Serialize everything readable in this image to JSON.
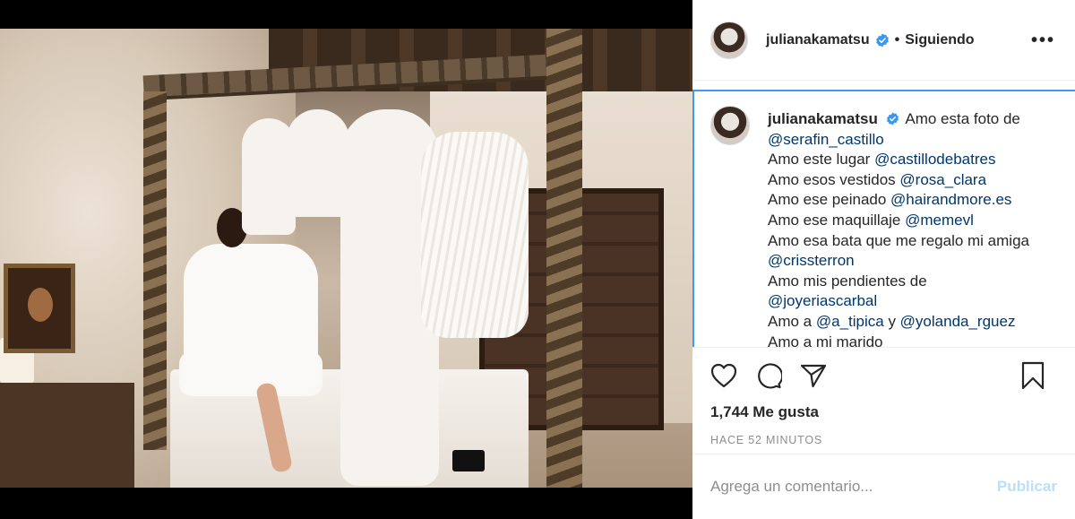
{
  "post": {
    "username": "julianakamatsu",
    "follow_separator": "•",
    "follow_status": "Siguiendo",
    "more_label": "•••"
  },
  "caption": {
    "username": "julianakamatsu",
    "lines": [
      {
        "text": "Amo esta foto de",
        "mention": ""
      },
      {
        "text": "",
        "mention": "@serafin_castillo"
      },
      {
        "text": "Amo este lugar ",
        "mention": "@castillodebatres"
      },
      {
        "text": "Amo esos vestidos ",
        "mention": "@rosa_clara"
      },
      {
        "text": "Amo ese peinado ",
        "mention": "@hairandmore.es"
      },
      {
        "text": "Amo ese maquillaje ",
        "mention": "@memevl"
      },
      {
        "text": "Amo esa bata que me regalo mi amiga",
        "mention": ""
      },
      {
        "text": "",
        "mention": "@crissterron"
      },
      {
        "text": "Amo mis pendientes de",
        "mention": ""
      },
      {
        "text": "",
        "mention": "@joyeriascarbal"
      },
      {
        "text": "Amo a ",
        "mention": "@a_tipica",
        "text2": " y ",
        "mention2": "@yolanda_rguez"
      },
      {
        "text": "Amo a mi marido",
        "mention": ""
      }
    ]
  },
  "actions": {
    "like_icon": "heart-icon",
    "comment_icon": "comment-icon",
    "share_icon": "paper-plane-icon",
    "save_icon": "bookmark-icon"
  },
  "likes": "1,744 Me gusta",
  "time_ago": "HACE 52 MINUTOS",
  "comment": {
    "placeholder": "Agrega un comentario...",
    "publish_label": "Publicar"
  },
  "colors": {
    "verified": "#3897f0",
    "mention": "#00376b",
    "publish_disabled": "#b9dffc",
    "focus_border": "#3f97f6"
  }
}
